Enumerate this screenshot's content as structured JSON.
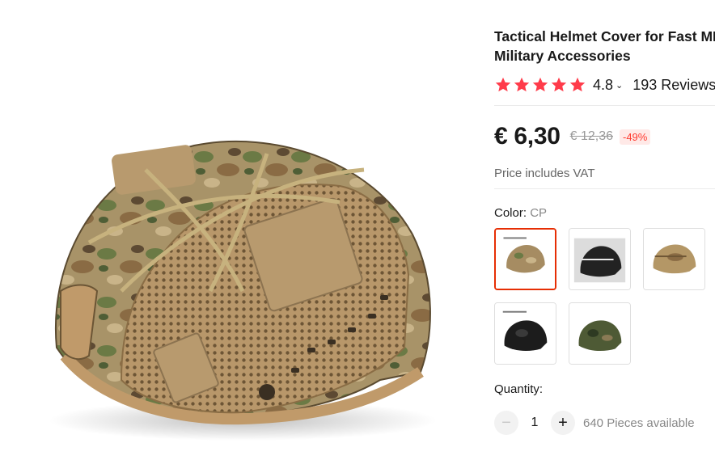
{
  "product": {
    "title_line1": "Tactical Helmet Cover for Fast MH",
    "title_line2": "Military Accessories",
    "image_name": "camouflage-helmet-cover-photo"
  },
  "rating": {
    "stars": 5,
    "value": "4.8",
    "chevron": "⌄",
    "reviews": "193 Reviews",
    "star_color": "#ff3b4a"
  },
  "price": {
    "current": "€ 6,30",
    "original": "€ 12,36",
    "discount": "-49%",
    "vat_note": "Price includes VAT",
    "accent_color": "#e62e04"
  },
  "color": {
    "label": "Color: ",
    "selected_value": "CP",
    "options": [
      {
        "name": "CP",
        "selected": true
      },
      {
        "name": "Black mesh",
        "selected": false
      },
      {
        "name": "Tan",
        "selected": false
      },
      {
        "name": "Black",
        "selected": false
      },
      {
        "name": "Green camo",
        "selected": false
      }
    ]
  },
  "quantity": {
    "label": "Quantity:",
    "minus": "−",
    "value": "1",
    "plus": "+",
    "available": "640 Pieces available"
  }
}
